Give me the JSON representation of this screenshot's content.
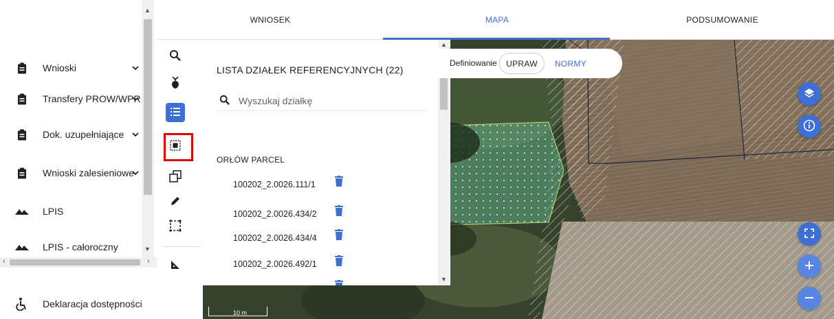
{
  "tabs": [
    {
      "label": "WNIOSEK",
      "active": false
    },
    {
      "label": "MAPA",
      "active": true
    },
    {
      "label": "PODSUMOWANIE",
      "active": false
    }
  ],
  "sidebar": {
    "items": [
      {
        "label": "Wnioski",
        "icon": "clipboard-icon",
        "has_chevron": true
      },
      {
        "label": "Transfery PROW/WPR",
        "icon": "clipboard-icon",
        "has_chevron": true
      },
      {
        "label": "Dok. uzupełniające",
        "icon": "clipboard-icon",
        "has_chevron": true
      },
      {
        "label": "Wnioski zalesieniowe",
        "icon": "clipboard-icon",
        "has_chevron": true
      },
      {
        "label": "LPIS",
        "icon": "mountains-icon",
        "has_chevron": false
      },
      {
        "label": "LPIS - całoroczny",
        "icon": "mountains-icon",
        "has_chevron": false
      }
    ],
    "footer_link": {
      "label": "Deklaracja dostępności",
      "icon": "accessibility-icon"
    }
  },
  "tools": [
    {
      "name": "search-icon",
      "active": false
    },
    {
      "name": "plant-icon",
      "active": false
    },
    {
      "name": "list-icon",
      "active": true
    },
    {
      "name": "select-parcel-icon",
      "active": false,
      "highlighted": true
    },
    {
      "name": "copy-icon",
      "active": false
    },
    {
      "name": "pencil-icon",
      "active": false
    },
    {
      "name": "dashed-rectangle-icon",
      "active": false
    },
    {
      "name": "ruler-triangle-icon",
      "active": false
    }
  ],
  "panel": {
    "title": "LISTA DZIAŁEK REFERENCYJNYCH (22)",
    "search_placeholder": "Wyszukaj działkę",
    "group_title": "ORŁÓW PARCEL",
    "parcels": [
      "100202_2.0026.111/1",
      "100202_2.0026.434/2",
      "100202_2.0026.434/4",
      "100202_2.0026.492/1"
    ]
  },
  "definition": {
    "label": "Definiowanie",
    "options": [
      {
        "label": "UPRAW",
        "selected": true
      },
      {
        "label": "NORMY",
        "selected": false
      }
    ]
  },
  "map": {
    "scale_label": "10 m",
    "controls": [
      "layers-icon",
      "info-icon",
      "fullscreen-icon",
      "zoom-in-icon",
      "zoom-out-icon"
    ]
  },
  "colors": {
    "accent": "#3d6fd6",
    "highlight_box": "#e00000",
    "selected_parcel_fill": "#5fae85"
  }
}
